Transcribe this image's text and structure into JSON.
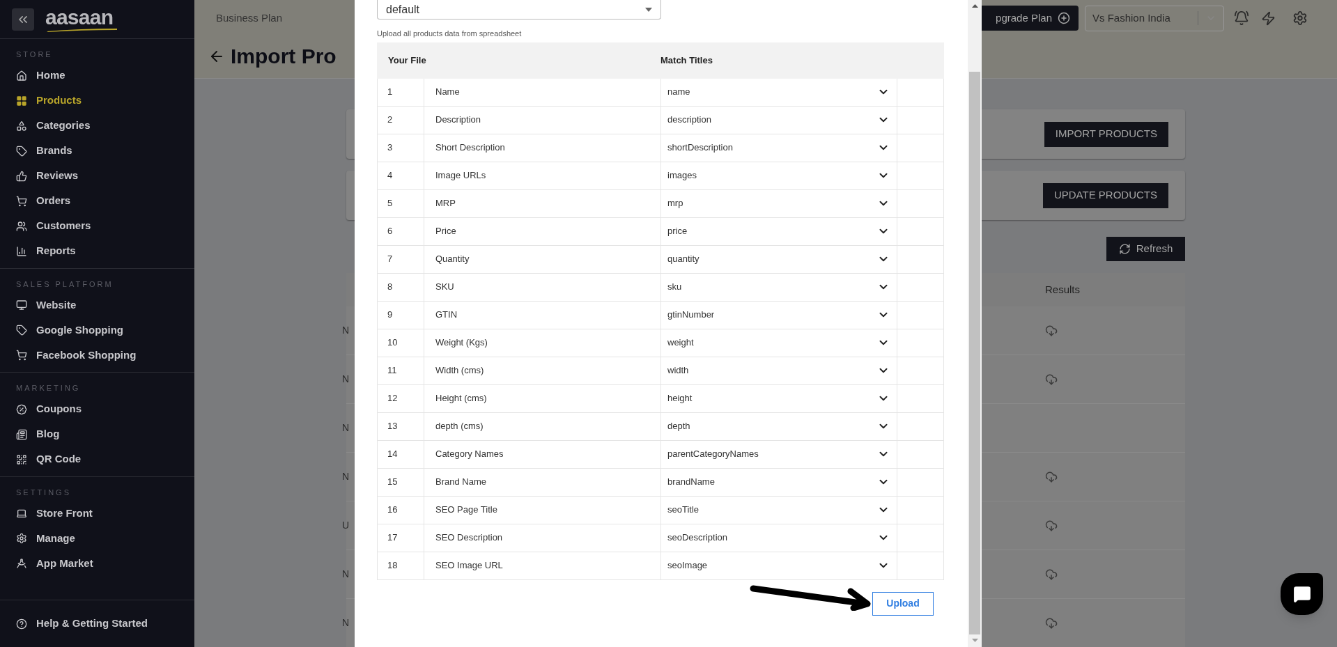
{
  "sidebar": {
    "logo": "aasaan",
    "sections": [
      {
        "heading": "STORE",
        "items": [
          {
            "label": "Home",
            "selected": false
          },
          {
            "label": "Products",
            "selected": true
          },
          {
            "label": "Categories",
            "selected": false
          },
          {
            "label": "Brands",
            "selected": false
          },
          {
            "label": "Reviews",
            "selected": false
          },
          {
            "label": "Orders",
            "selected": false
          },
          {
            "label": "Customers",
            "selected": false
          },
          {
            "label": "Reports",
            "selected": false
          }
        ]
      },
      {
        "heading": "SALES PLATFORM",
        "items": [
          {
            "label": "Website",
            "selected": false
          },
          {
            "label": "Google Shopping",
            "selected": false
          },
          {
            "label": "Facebook Shopping",
            "selected": false
          }
        ]
      },
      {
        "heading": "MARKETING",
        "items": [
          {
            "label": "Coupons",
            "selected": false
          },
          {
            "label": "Blog",
            "selected": false
          },
          {
            "label": "QR Code",
            "selected": false
          }
        ]
      },
      {
        "heading": "SETTINGS",
        "items": [
          {
            "label": "Store Front",
            "selected": false
          },
          {
            "label": "Manage",
            "selected": false
          },
          {
            "label": "App Market",
            "selected": false
          }
        ]
      }
    ],
    "footer_item": "Help & Getting Started"
  },
  "header": {
    "plan": "Business Plan",
    "upgrade_button": "pgrade Plan",
    "store_select": "Vs Fashion India"
  },
  "page": {
    "title": "Import Pro",
    "cards": [
      {
        "button": "IMPORT PRODUCTS"
      },
      {
        "button": "UPDATE PRODUCTS"
      }
    ],
    "refresh_button": "Refresh",
    "results_table": {
      "column": "Results",
      "rows": [
        {
          "cell": "N",
          "has_result": true
        },
        {
          "cell": "N",
          "has_result": true
        },
        {
          "cell": "N",
          "has_result": false
        },
        {
          "cell": "N",
          "has_result": true
        },
        {
          "cell": "U",
          "has_result": true
        },
        {
          "cell": "N",
          "has_result": true
        },
        {
          "cell": "N",
          "has_result": true
        }
      ]
    }
  },
  "modal": {
    "template_select": "default",
    "hint": "Upload all products data from spreadsheet",
    "columns": [
      "Your File",
      "Match Titles"
    ],
    "rows": [
      {
        "number": "1",
        "name": "Name",
        "match": "name"
      },
      {
        "number": "2",
        "name": "Description",
        "match": "description"
      },
      {
        "number": "3",
        "name": "Short Description",
        "match": "shortDescription"
      },
      {
        "number": "4",
        "name": "Image URLs",
        "match": "images"
      },
      {
        "number": "5",
        "name": "MRP",
        "match": "mrp"
      },
      {
        "number": "6",
        "name": "Price",
        "match": "price"
      },
      {
        "number": "7",
        "name": "Quantity",
        "match": "quantity"
      },
      {
        "number": "8",
        "name": "SKU",
        "match": "sku"
      },
      {
        "number": "9",
        "name": "GTIN",
        "match": "gtinNumber"
      },
      {
        "number": "10",
        "name": "Weight (Kgs)",
        "match": "weight"
      },
      {
        "number": "11",
        "name": "Width (cms)",
        "match": "width"
      },
      {
        "number": "12",
        "name": "Height (cms)",
        "match": "height"
      },
      {
        "number": "13",
        "name": "depth (cms)",
        "match": "depth"
      },
      {
        "number": "14",
        "name": "Category Names",
        "match": "parentCategoryNames"
      },
      {
        "number": "15",
        "name": "Brand Name",
        "match": "brandName"
      },
      {
        "number": "16",
        "name": "SEO Page Title",
        "match": "seoTitle"
      },
      {
        "number": "17",
        "name": "SEO Description",
        "match": "seoDescription"
      },
      {
        "number": "18",
        "name": "SEO Image URL",
        "match": "seoImage"
      }
    ],
    "upload_button": "Upload"
  }
}
